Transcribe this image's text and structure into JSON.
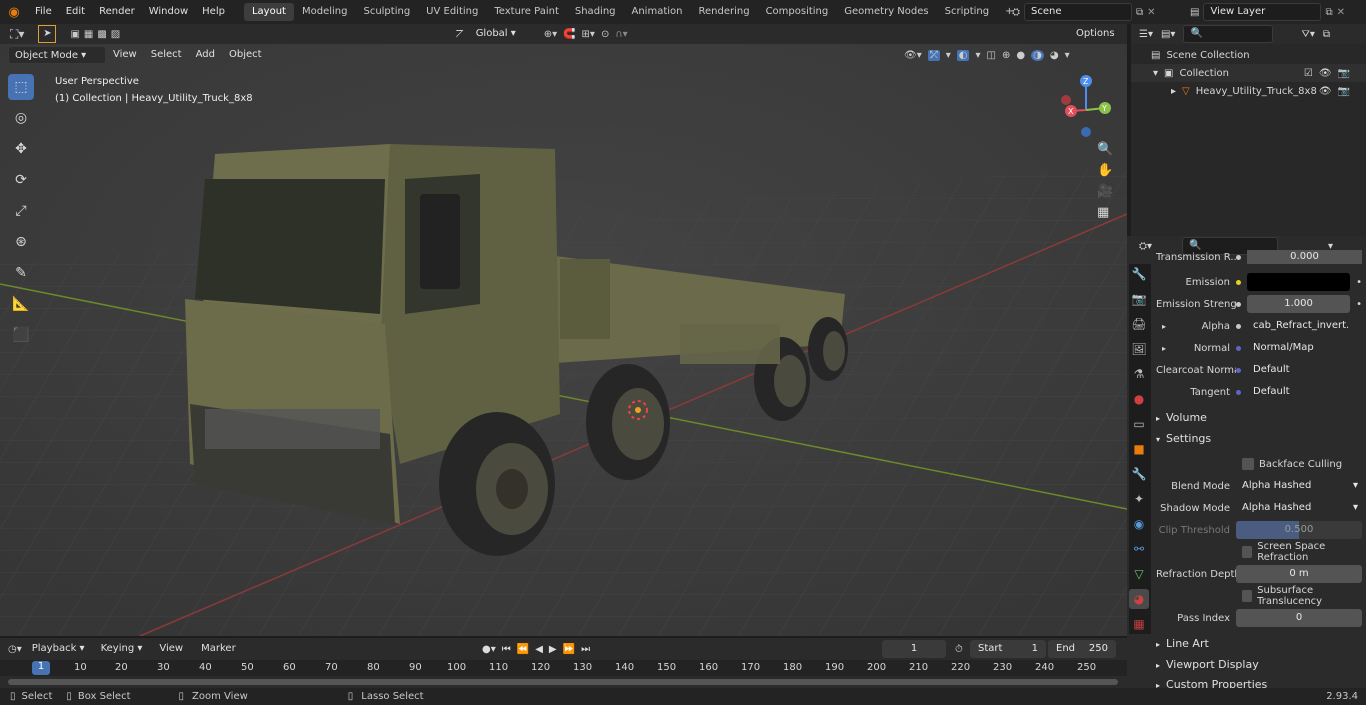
{
  "menubar": {
    "file": "File",
    "edit": "Edit",
    "render": "Render",
    "window": "Window",
    "help": "Help"
  },
  "workspaces": [
    "Layout",
    "Modeling",
    "Sculpting",
    "UV Editing",
    "Texture Paint",
    "Shading",
    "Animation",
    "Rendering",
    "Compositing",
    "Geometry Nodes",
    "Scripting"
  ],
  "scene": {
    "name": "Scene",
    "view_layer": "View Layer"
  },
  "viewport_header": {
    "mode": "Object Mode",
    "view": "View",
    "select": "Select",
    "add": "Add",
    "object": "Object",
    "orientation": "Global",
    "options": "Options"
  },
  "viewport": {
    "perspective": "User Perspective",
    "collection_line": "(1) Collection | Heavy_Utility_Truck_8x8"
  },
  "outliner": {
    "scene_collection": "Scene Collection",
    "collection": "Collection",
    "object": "Heavy_Utility_Truck_8x8"
  },
  "properties": {
    "transmission_label": "Transmission R...",
    "transmission_value": "0.000",
    "emission_label": "Emission",
    "emission_strength_label": "Emission Strengt",
    "emission_strength_value": "1.000",
    "alpha_label": "Alpha",
    "alpha_value": "cab_Refract_invert.p...",
    "normal_label": "Normal",
    "normal_value": "Normal/Map",
    "clearcoat_label": "Clearcoat Normal",
    "clearcoat_value": "Default",
    "tangent_label": "Tangent",
    "tangent_value": "Default",
    "volume": "Volume",
    "settings": "Settings",
    "backface": "Backface Culling",
    "blend_label": "Blend Mode",
    "blend_value": "Alpha Hashed",
    "shadow_label": "Shadow Mode",
    "shadow_value": "Alpha Hashed",
    "clip_label": "Clip Threshold",
    "clip_value": "0.500",
    "ssr": "Screen Space Refraction",
    "refr_label": "Refraction Depth",
    "refr_value": "0 m",
    "subsurface": "Subsurface Translucency",
    "pass_label": "Pass Index",
    "pass_value": "0",
    "line_art": "Line Art",
    "viewport_display": "Viewport Display",
    "custom_props": "Custom Properties"
  },
  "timeline": {
    "playback": "Playback",
    "keying": "Keying",
    "view": "View",
    "marker": "Marker",
    "current_frame": "1",
    "start_label": "Start",
    "start": "1",
    "end_label": "End",
    "end": "250",
    "ruler": [
      "1",
      "10",
      "20",
      "30",
      "40",
      "50",
      "60",
      "70",
      "80",
      "90",
      "100",
      "110",
      "120",
      "130",
      "140",
      "150",
      "160",
      "170",
      "180",
      "190",
      "200",
      "210",
      "220",
      "230",
      "240",
      "250"
    ]
  },
  "statusbar": {
    "select": "Select",
    "box_select": "Box Select",
    "zoom_view": "Zoom View",
    "lasso": "Lasso Select",
    "version": "2.93.4"
  },
  "colors": {
    "accent": "#4772b3",
    "x_axis": "#e44d5a",
    "y_axis": "#8bc34a",
    "z_axis": "#4d8ef0",
    "active_tab": "#3d3d3d"
  }
}
